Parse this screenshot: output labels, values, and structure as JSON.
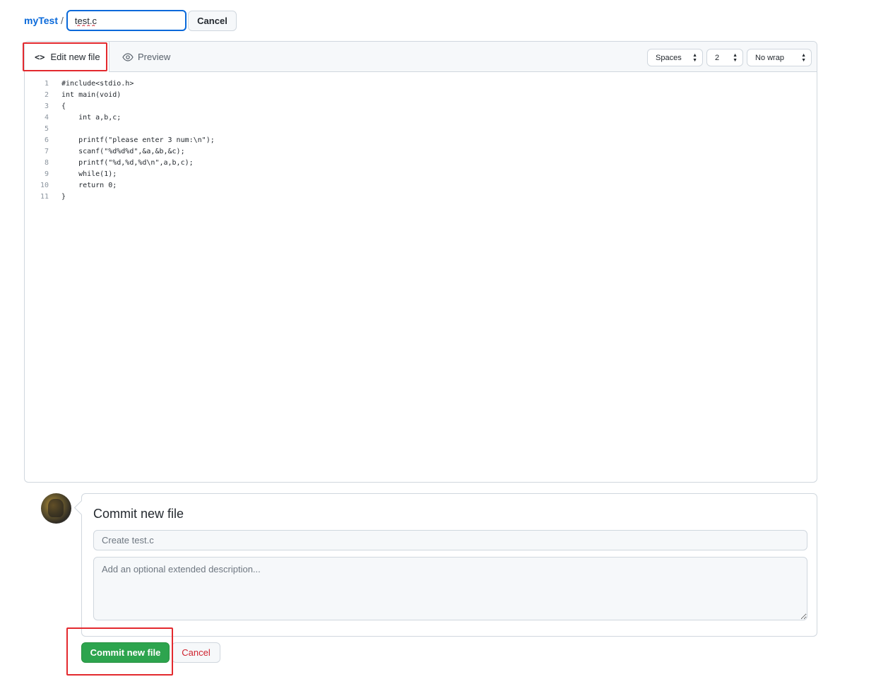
{
  "breadcrumb": {
    "repo": "myTest",
    "separator": "/",
    "filename": "test.c"
  },
  "top": {
    "cancel_label": "Cancel"
  },
  "editor": {
    "tabs": {
      "edit_label": "Edit new file",
      "preview_label": "Preview"
    },
    "options": {
      "indent_mode": "Spaces",
      "indent_size": "2",
      "wrap_mode": "No wrap"
    },
    "lines": [
      {
        "n": "1",
        "text": "#include<stdio.h>"
      },
      {
        "n": "2",
        "text": "int main(void)"
      },
      {
        "n": "3",
        "text": "{"
      },
      {
        "n": "4",
        "text": "    int a,b,c;"
      },
      {
        "n": "5",
        "text": ""
      },
      {
        "n": "6",
        "text": "    printf(\"please enter 3 num:\\n\");"
      },
      {
        "n": "7",
        "text": "    scanf(\"%d%d%d\",&a,&b,&c);"
      },
      {
        "n": "8",
        "text": "    printf(\"%d,%d,%d\\n\",a,b,c);"
      },
      {
        "n": "9",
        "text": "    while(1);"
      },
      {
        "n": "10",
        "text": "    return 0;"
      },
      {
        "n": "11",
        "text": "}"
      }
    ]
  },
  "commit": {
    "title": "Commit new file",
    "summary_placeholder": "Create test.c",
    "description_placeholder": "Add an optional extended description...",
    "commit_label": "Commit new file",
    "cancel_label": "Cancel"
  },
  "colors": {
    "link": "#0969da",
    "commit_button": "#2da44e",
    "highlight": "#e3292e",
    "danger": "#cf222e"
  }
}
